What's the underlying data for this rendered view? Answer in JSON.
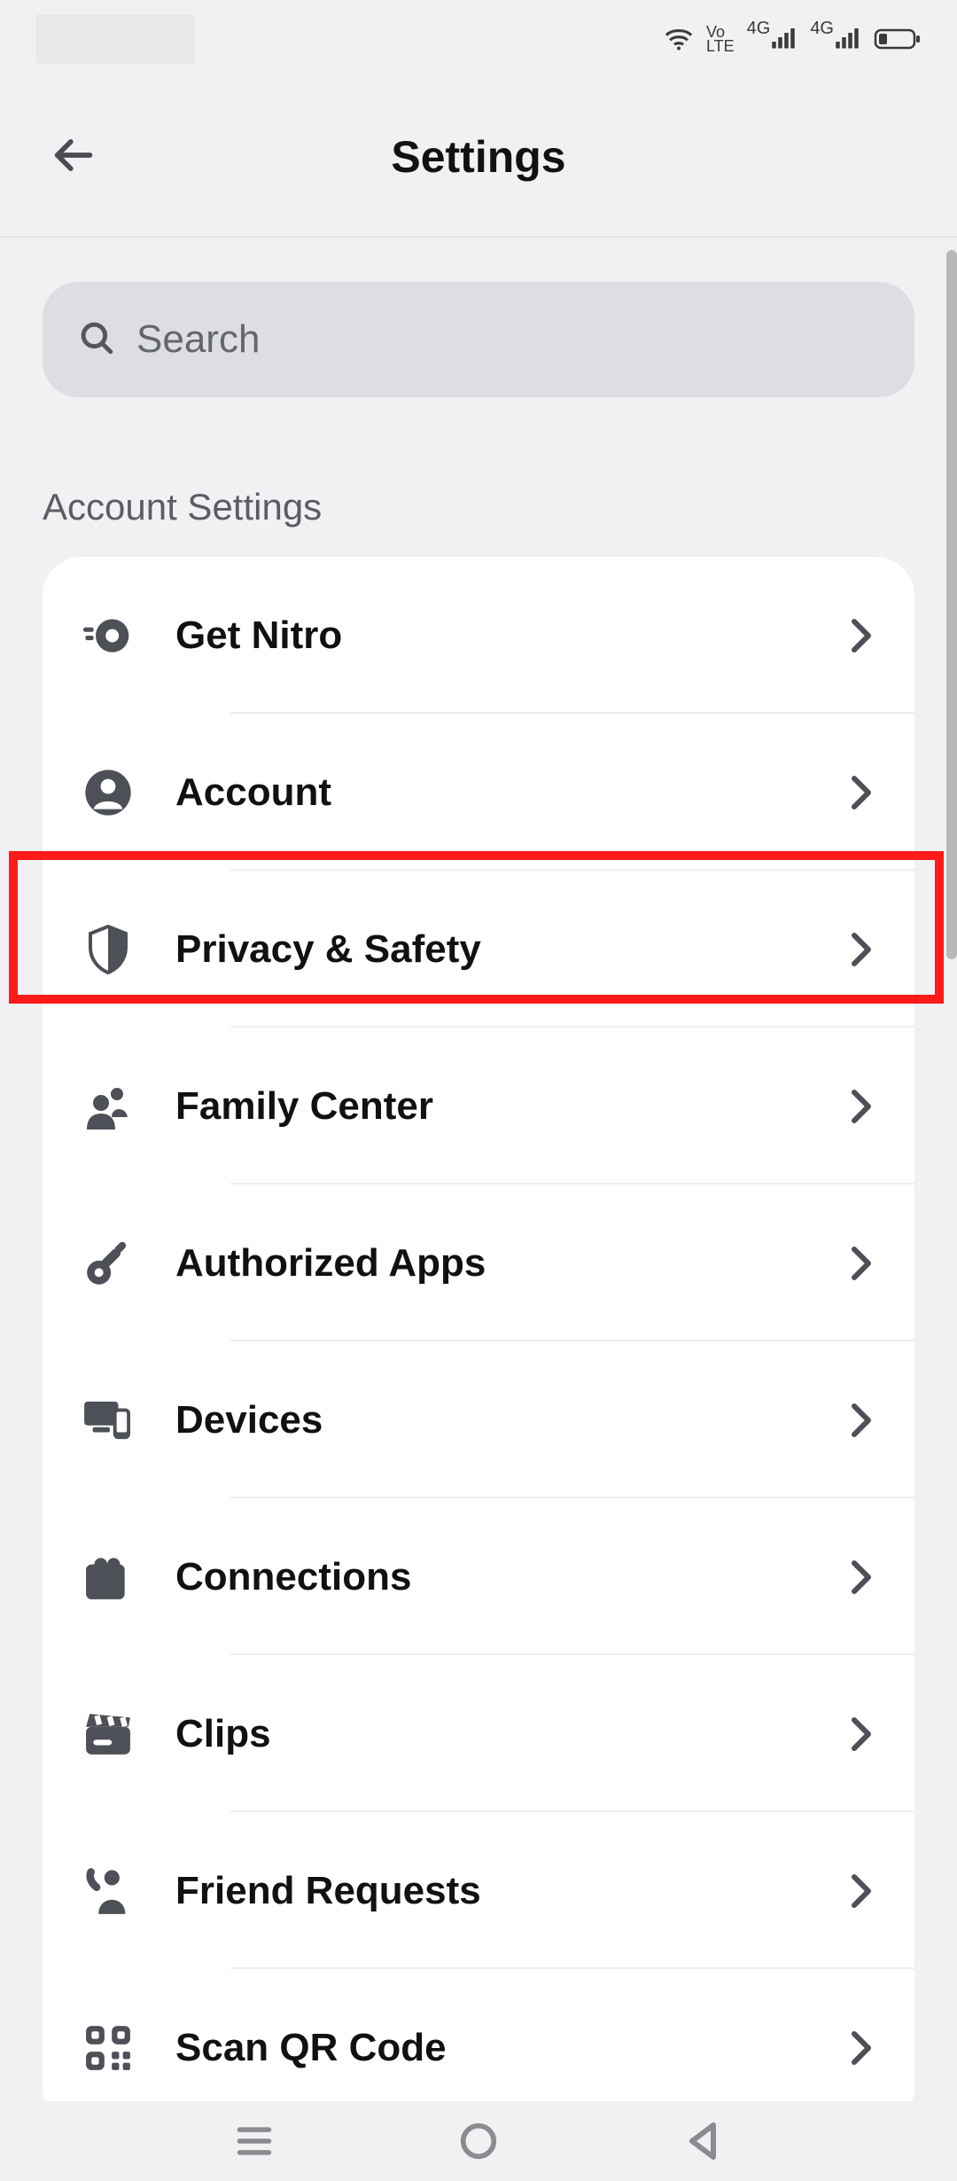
{
  "status": {
    "volte_top": "Vo",
    "volte_bottom": "LTE",
    "net1": "4G",
    "net2": "4G"
  },
  "header": {
    "title": "Settings"
  },
  "search": {
    "placeholder": "Search"
  },
  "section_account": {
    "label": "Account Settings"
  },
  "rows": {
    "nitro": "Get Nitro",
    "account": "Account",
    "privacy": "Privacy & Safety",
    "family": "Family Center",
    "apps": "Authorized Apps",
    "devices": "Devices",
    "connections": "Connections",
    "clips": "Clips",
    "friends": "Friend Requests",
    "qr": "Scan QR Code"
  },
  "highlight": {
    "target": "privacy"
  }
}
